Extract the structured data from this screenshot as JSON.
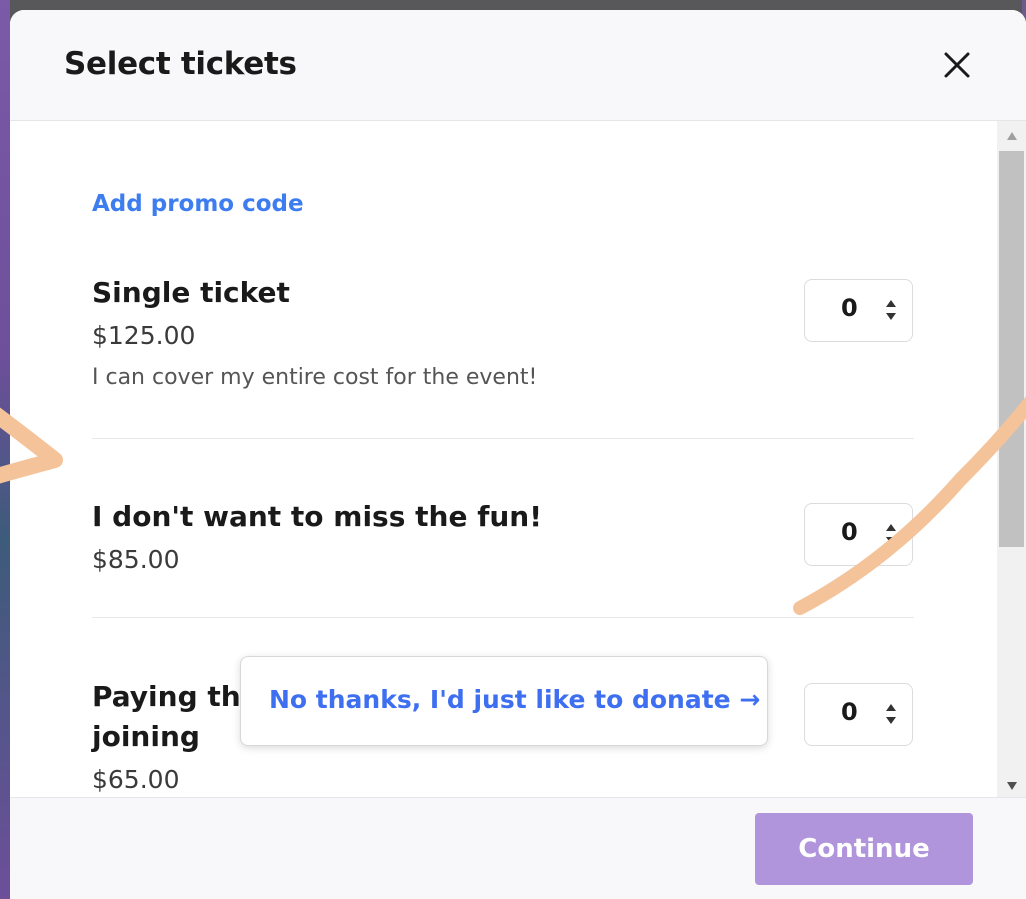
{
  "modal": {
    "title": "Select tickets",
    "close_icon": "close-icon"
  },
  "promo": {
    "label": "Add promo code"
  },
  "tickets": [
    {
      "name": "Single ticket",
      "price": "$125.00",
      "description": "I can cover my entire cost for the event!",
      "quantity": "0"
    },
    {
      "name": "I don't want to miss the fun!",
      "price": "$85.00",
      "quantity": "0"
    },
    {
      "name_line1": "Paying th",
      "name_line2": "joining",
      "price": "$65.00",
      "quantity": "0"
    }
  ],
  "donate": {
    "label": "No thanks, I'd just like to donate",
    "arrow": "→"
  },
  "footer": {
    "continue_label": "Continue"
  },
  "colors": {
    "accent_link": "#3d7df0",
    "continue_button": "#b094dc",
    "scribble": "#f5c39a"
  }
}
